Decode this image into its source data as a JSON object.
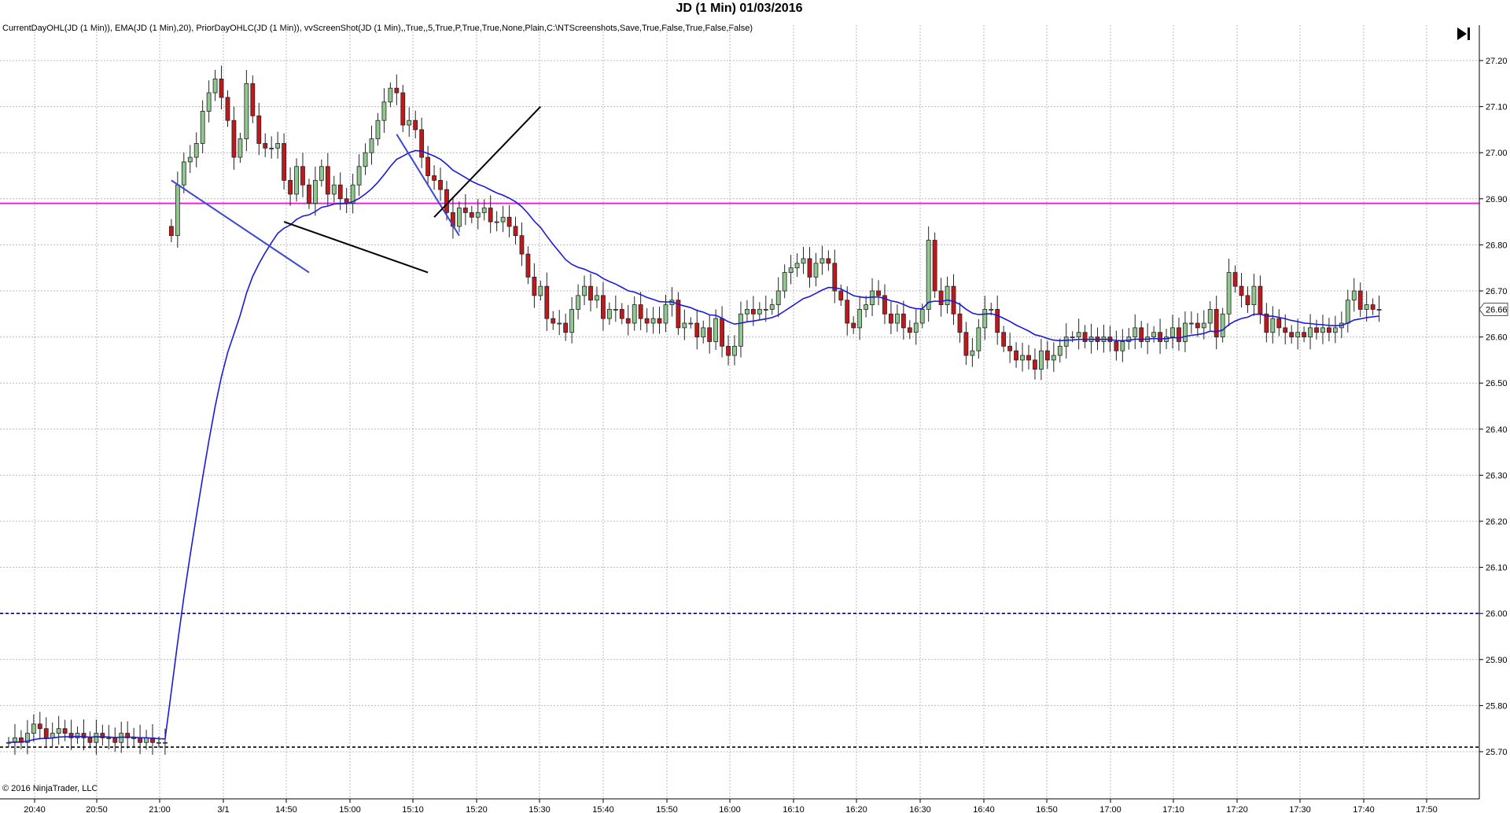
{
  "title": "JD (1 Min)  01/03/2016",
  "indicator_text": "CurrentDayOHL(JD (1 Min)), EMA(JD (1 Min),20), PriorDayOHLC(JD (1 Min)), vvScreenShot(JD (1 Min),,True,,5,True,P,True,True,None,Plain,C:\\NTScreenshots,Save,True,False,True,False,False)",
  "copyright": "© 2016 NinjaTrader, LLC",
  "last_price_label": "26.66",
  "colors": {
    "up_candle": "#90c890",
    "down_candle": "#c0181c",
    "ema": "#1a1adc",
    "prior_level": "#ee22dd",
    "prior_low_dashed": "#0000b0",
    "current_low_dashed": "#000000",
    "grid": "#b8b8b8"
  },
  "chart_data": {
    "type": "candlestick",
    "ylim": [
      25.66,
      27.24
    ],
    "y_ticks": [
      "27.20",
      "27.10",
      "27.00",
      "26.90",
      "26.80",
      "26.70",
      "26.60",
      "26.50",
      "26.40",
      "26.30",
      "26.20",
      "26.10",
      "26.00",
      "25.90",
      "25.80",
      "25.70"
    ],
    "x_ticks": [
      "20:40",
      "20:50",
      "21:00",
      "3/1",
      "14:50",
      "15:00",
      "15:10",
      "15:20",
      "15:30",
      "15:40",
      "15:50",
      "16:00",
      "16:10",
      "16:20",
      "16:30",
      "16:40",
      "16:50",
      "17:00",
      "17:10",
      "17:20",
      "17:30",
      "17:40",
      "17:50"
    ],
    "horizontal_levels": [
      {
        "value": 26.89,
        "style": "solid",
        "color": "#ee22dd"
      },
      {
        "value": 26.0,
        "style": "dashed",
        "color": "#0000b0"
      },
      {
        "value": 25.71,
        "style": "dashed",
        "color": "#000000"
      }
    ],
    "drawn_lines": [
      {
        "from": [
          1,
          26.94
        ],
        "to": [
          23,
          26.74
        ],
        "color": "#3a4ad0"
      },
      {
        "from": [
          19,
          26.85
        ],
        "to": [
          42,
          26.74
        ],
        "color": "#000000"
      },
      {
        "from": [
          37,
          27.04
        ],
        "to": [
          47,
          26.82
        ],
        "color": "#3a4ad0"
      },
      {
        "from": [
          43,
          26.86
        ],
        "to": [
          60,
          27.1
        ],
        "color": "#000000"
      }
    ],
    "ohlc_segments": [
      {
        "start_index": 0,
        "start": 25.72,
        "path": [
          25.72,
          25.73,
          25.72,
          25.74,
          25.76,
          25.75,
          25.73,
          25.74,
          25.75,
          25.74,
          25.73,
          25.74,
          25.73,
          25.72,
          25.74,
          25.73,
          25.73,
          25.72,
          25.74,
          25.73,
          25.73,
          25.72,
          25.73,
          25.72,
          25.72,
          25.72
        ]
      },
      {
        "start_index": 26,
        "start": 26.84,
        "path": [
          26.82,
          26.93,
          26.98,
          26.99,
          27.02,
          27.09,
          27.13,
          27.16,
          27.12,
          27.07,
          26.99,
          27.03,
          27.15,
          27.08,
          27.02,
          27.01,
          27.01,
          27.02,
          26.94,
          26.91,
          26.97,
          26.93,
          26.89,
          26.94,
          26.97,
          26.91,
          26.93,
          26.9,
          26.89,
          26.93,
          26.97,
          27.0,
          27.03,
          27.07,
          27.11,
          27.14,
          27.13,
          27.06,
          27.07,
          27.05,
          26.99,
          26.95,
          26.94,
          26.92,
          26.87,
          26.84,
          26.88,
          26.87,
          26.86,
          26.87,
          26.88,
          26.85,
          26.85,
          26.86,
          26.84,
          26.82,
          26.78,
          26.73,
          26.69,
          26.71,
          26.64,
          26.63,
          26.63,
          26.61,
          26.66,
          26.69,
          26.71,
          26.68,
          26.69,
          26.64,
          26.66,
          26.66,
          26.64,
          26.63,
          26.67,
          26.64,
          26.63,
          26.64,
          26.63,
          26.67,
          26.68,
          26.62,
          26.63,
          26.63,
          26.6,
          26.62,
          26.59,
          26.64,
          26.58,
          26.56,
          26.58,
          26.65,
          26.66,
          26.65,
          26.66,
          26.66,
          26.67,
          26.7,
          26.74,
          26.75,
          26.76,
          26.77,
          26.73,
          26.76,
          26.77,
          26.76,
          26.7,
          26.68,
          26.63,
          26.62,
          26.66,
          26.67,
          26.7,
          26.69,
          26.65,
          26.63,
          26.65,
          26.62,
          26.61,
          26.63,
          26.66,
          26.81,
          26.7,
          26.67,
          26.71,
          26.65,
          26.61,
          26.56,
          26.57,
          26.62,
          26.66,
          26.66,
          26.61,
          26.58,
          26.57,
          26.55,
          26.56,
          26.55,
          26.53,
          26.57,
          26.55,
          26.56,
          26.58,
          26.6,
          26.6,
          26.61,
          26.59,
          26.6,
          26.59,
          26.6,
          26.59,
          26.57,
          26.59,
          26.6,
          26.62,
          26.59,
          26.6,
          26.61,
          26.59,
          26.6,
          26.62,
          26.59,
          26.63,
          26.63,
          26.62,
          26.63,
          26.66,
          26.6,
          26.65,
          26.74,
          26.71,
          26.69,
          26.67,
          26.71,
          26.65,
          26.61,
          26.64,
          26.62,
          26.61,
          26.6,
          26.61,
          26.6,
          26.62,
          26.61,
          26.62,
          26.61,
          26.62,
          26.63,
          26.68,
          26.7,
          26.66,
          26.67,
          26.66,
          26.66
        ]
      }
    ]
  }
}
